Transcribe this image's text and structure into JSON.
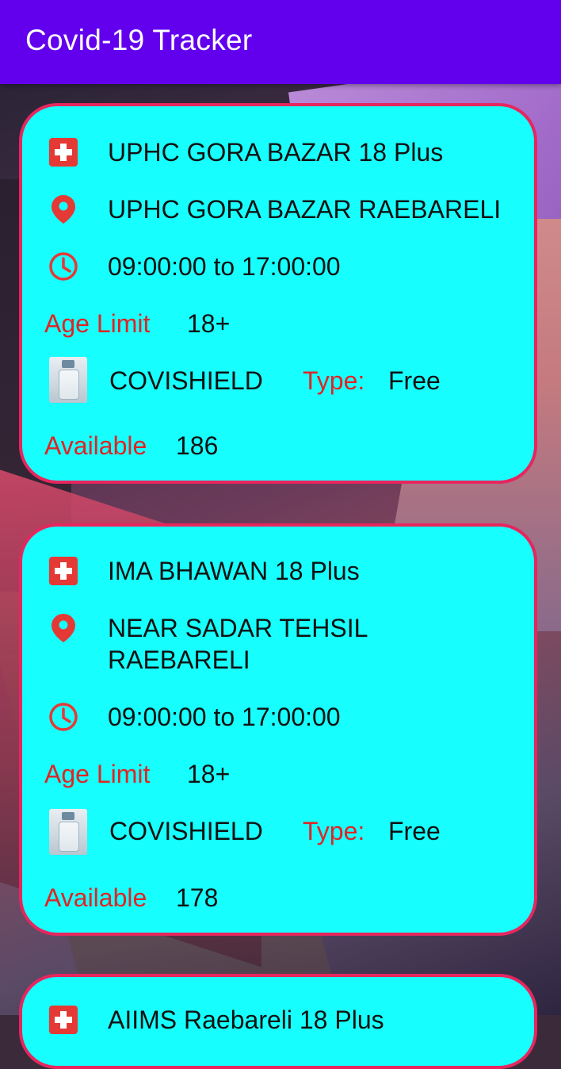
{
  "appbar": {
    "title": "Covid-19 Tracker"
  },
  "colors": {
    "appbar": "#6200ee",
    "card_bg": "#17fefe",
    "card_border": "#e6265e",
    "label_red": "#e02424"
  },
  "centers": [
    {
      "name": "UPHC GORA BAZAR 18 Plus",
      "address": "UPHC GORA BAZAR RAEBARELI",
      "timing": "09:00:00 to 17:00:00",
      "age_label": "Age Limit",
      "age_value": "18+",
      "vaccine": "COVISHIELD",
      "type_label": "Type:",
      "type_value": "Free",
      "available_label": "Available",
      "available_value": "186"
    },
    {
      "name": "IMA BHAWAN 18 Plus",
      "address": "NEAR SADAR TEHSIL RAEBARELI",
      "timing": "09:00:00 to 17:00:00",
      "age_label": "Age Limit",
      "age_value": "18+",
      "vaccine": "COVISHIELD",
      "type_label": "Type:",
      "type_value": "Free",
      "available_label": "Available",
      "available_value": "178"
    },
    {
      "name": "AIIMS Raebareli 18 Plus"
    }
  ],
  "icons": {
    "hospital": "hospital-cross-icon",
    "location": "location-pin-icon",
    "clock": "clock-icon",
    "vaccine": "vaccine-vial-image"
  }
}
